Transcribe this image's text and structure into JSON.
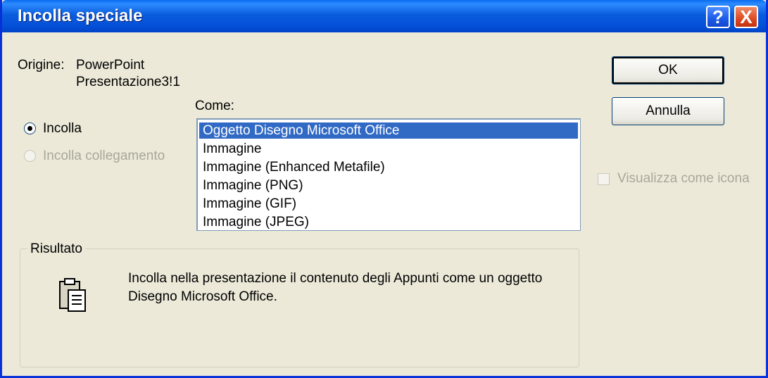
{
  "window": {
    "title": "Incolla speciale",
    "help_button": "?",
    "close_button": "X"
  },
  "origin": {
    "label": "Origine:",
    "line1": "PowerPoint",
    "line2": "Presentazione3!1"
  },
  "as_label": "Come:",
  "options": {
    "paste": {
      "label": "Incolla",
      "selected": true,
      "enabled": true
    },
    "paste_link": {
      "label": "Incolla collegamento",
      "selected": false,
      "enabled": false
    }
  },
  "formats": [
    "Oggetto Disegno Microsoft Office",
    "Immagine",
    "Immagine (Enhanced Metafile)",
    "Immagine (PNG)",
    "Immagine (GIF)",
    "Immagine (JPEG)"
  ],
  "selected_format_index": 0,
  "buttons": {
    "ok": "OK",
    "cancel": "Annulla"
  },
  "display_as_icon": {
    "label": "Visualizza come icona",
    "checked": false,
    "enabled": false
  },
  "result": {
    "label": "Risultato",
    "icon": "clipboard-paste-icon",
    "text": "Incolla nella presentazione il contenuto degli Appunti come un oggetto Disegno Microsoft Office."
  },
  "colors": {
    "title_bar": "#0a5ddd",
    "selection": "#316ac5",
    "dialog_bg": "#ece9d8",
    "disabled_text": "#a9a79a"
  }
}
